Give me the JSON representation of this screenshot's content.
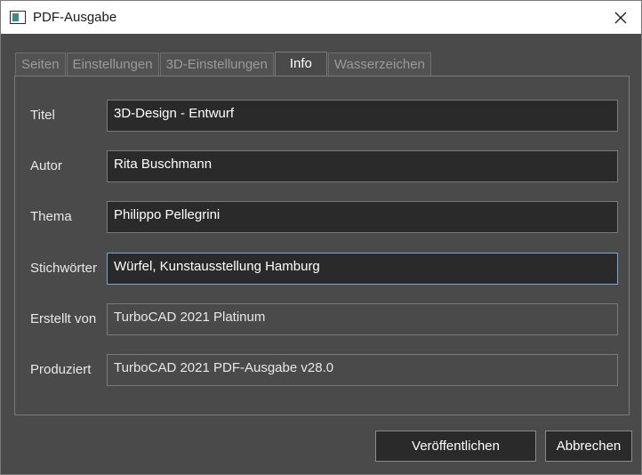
{
  "window": {
    "title": "PDF-Ausgabe",
    "close_glyph": "✕"
  },
  "tabs": [
    {
      "label": "Seiten",
      "active": false
    },
    {
      "label": "Einstellungen",
      "active": false
    },
    {
      "label": "3D-Einstellungen",
      "active": false
    },
    {
      "label": "Info",
      "active": true
    },
    {
      "label": "Wasserzeichen",
      "active": false
    }
  ],
  "fields": [
    {
      "label": "Titel",
      "value": "3D-Design - Entwurf",
      "editable": true
    },
    {
      "label": "Autor",
      "value": "Rita Buschmann",
      "editable": true
    },
    {
      "label": "Thema",
      "value": "Philippo Pellegrini",
      "editable": true
    },
    {
      "label": "Stichwörter",
      "value": "Würfel, Kunstausstellung Hamburg",
      "editable": true,
      "focused": true
    },
    {
      "label": "Erstellt von",
      "value": "TurboCAD 2021 Platinum",
      "editable": false
    },
    {
      "label": "Produziert",
      "value": "TurboCAD 2021 PDF-Ausgabe v28.0",
      "editable": false
    }
  ],
  "buttons": {
    "publish_label": "Veröffentlichen",
    "cancel_label": "Abbrechen"
  },
  "colors": {
    "background": "#4a4a4a",
    "field_bg": "#2a2a2a",
    "focus_border": "#7aa4d4",
    "text": "#ffffff"
  }
}
